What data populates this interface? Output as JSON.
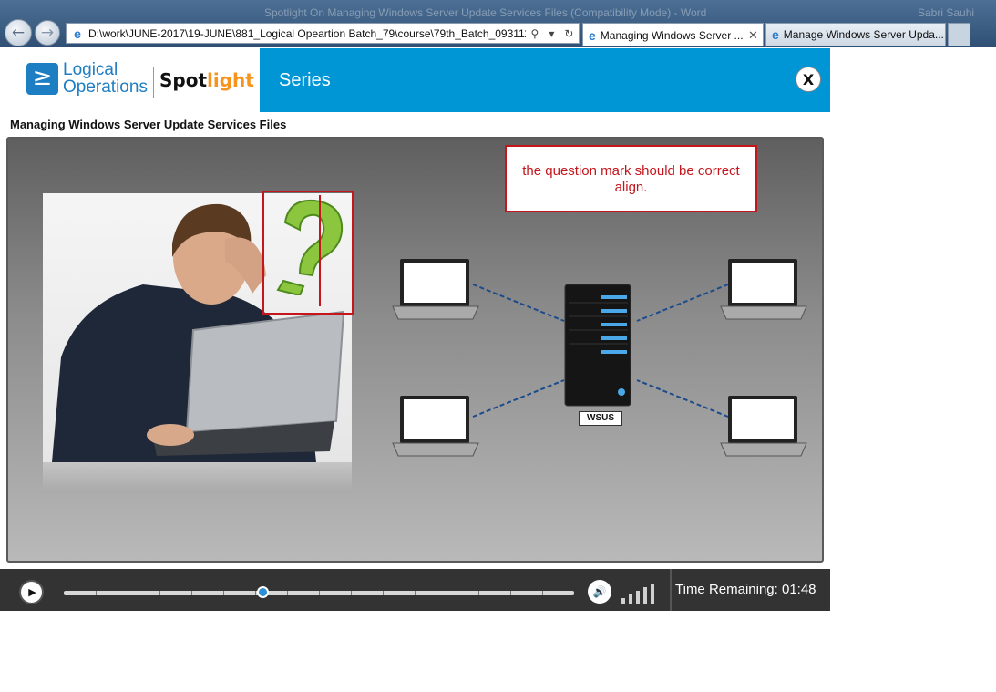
{
  "browser": {
    "window_title": "Spotlight On Managing Windows Server Update Services Files (Compatibility Mode) - Word",
    "user_name": "Sabri Sauhi",
    "address": "D:\\work\\JUNE-2017\\19-JUNE\\881_Logical Opeartion Batch_79\\course\\79th_Batch_093111\\09",
    "tabs": [
      {
        "label": "Managing Windows Server ...",
        "close": "✕"
      },
      {
        "label": "Manage Windows Server Upda..."
      }
    ]
  },
  "app": {
    "logo_line1": "Logical",
    "logo_line2": "Operations",
    "product_dark": "Spot",
    "product_light": "light",
    "section": "Series",
    "close_label": "X"
  },
  "page": {
    "title": "Managing Windows Server Update Services Files"
  },
  "slide": {
    "note": "the question mark should be correct align.",
    "server_label": "WSUS"
  },
  "player": {
    "progress": 0.39,
    "time_remaining": "Time Remaining: 01:48",
    "volume_bars": 5
  },
  "colors": {
    "brand_blue": "#0096d6",
    "annotation_red": "#c4161c",
    "accent_orange": "#f7941d"
  }
}
